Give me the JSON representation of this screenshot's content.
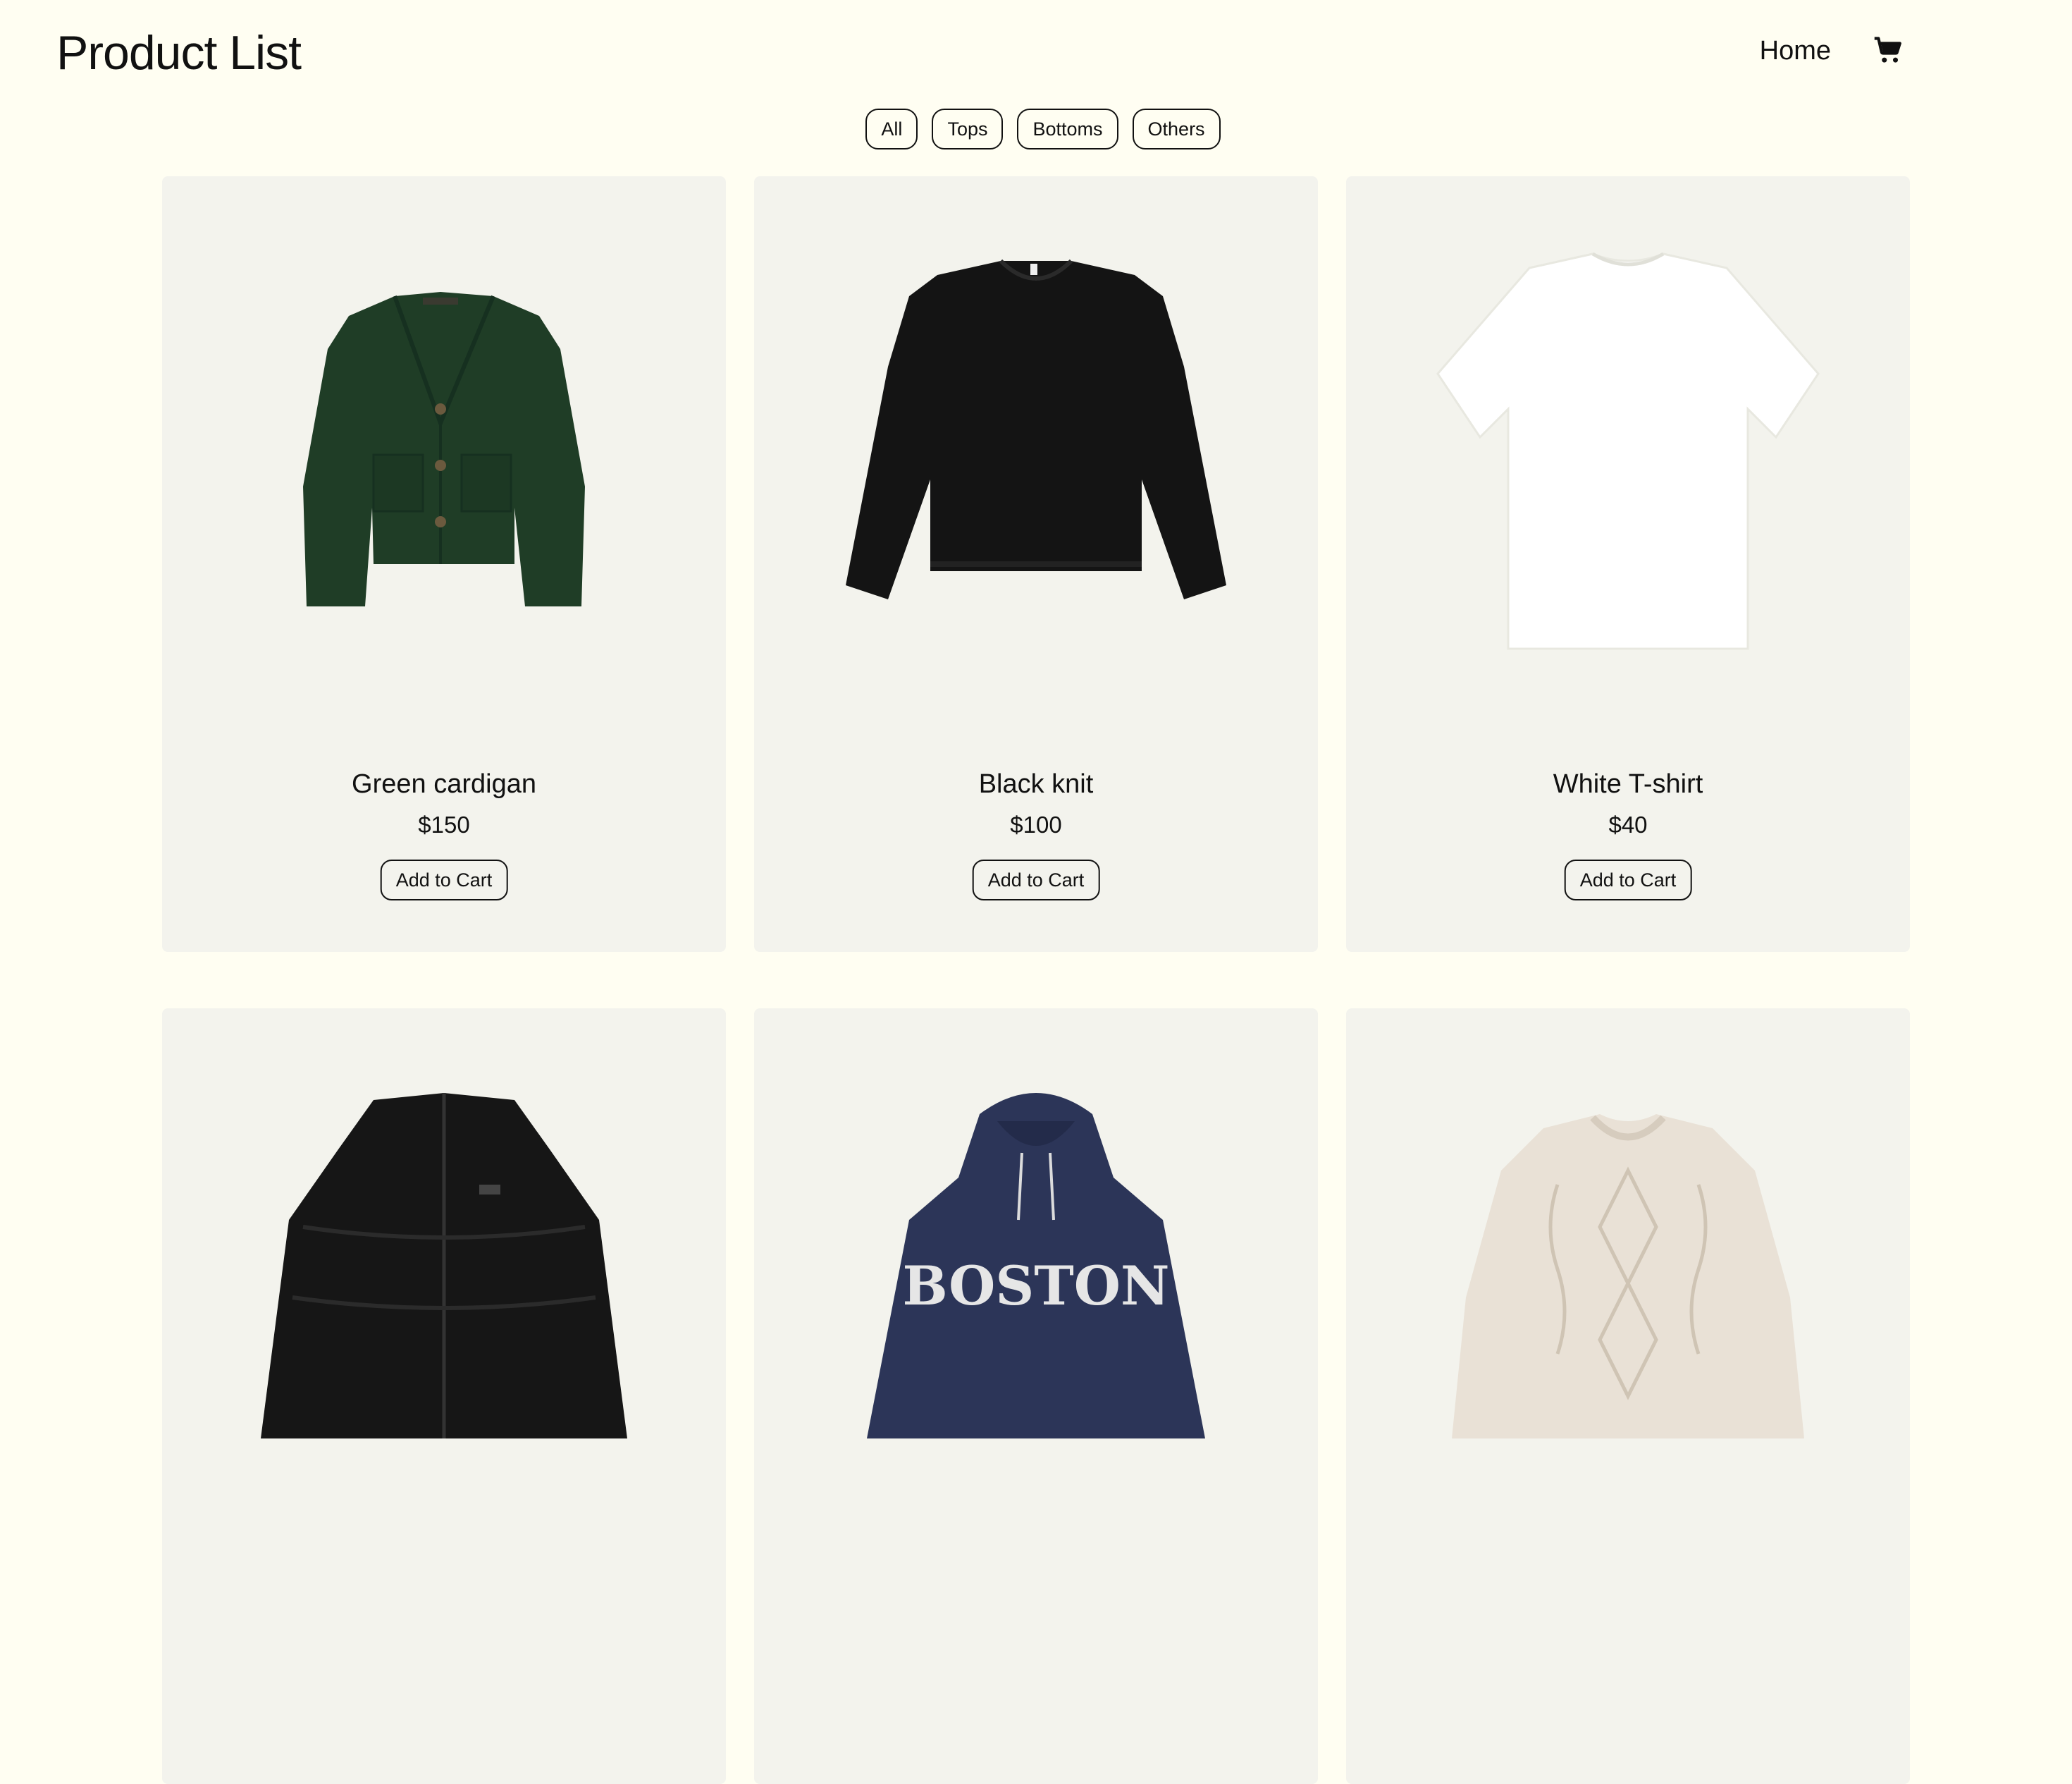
{
  "header": {
    "title": "Product List",
    "nav_home": "Home",
    "cart_icon": "shopping-cart-icon"
  },
  "filters": [
    {
      "label": "All"
    },
    {
      "label": "Tops"
    },
    {
      "label": "Bottoms"
    },
    {
      "label": "Others"
    }
  ],
  "products": [
    {
      "name": "Green cardigan",
      "price": "$150",
      "button": "Add to Cart",
      "image": "green-cardigan-image",
      "color": "#1f3d26"
    },
    {
      "name": "Black knit",
      "price": "$100",
      "button": "Add to Cart",
      "image": "black-knit-sweater-image",
      "color": "#141414"
    },
    {
      "name": "White T-shirt",
      "price": "$40",
      "button": "Add to Cart",
      "image": "white-tshirt-image",
      "color": "#ffffff"
    },
    {
      "image": "black-puffer-jacket-image",
      "color": "#161616"
    },
    {
      "image": "navy-boston-hoodie-image",
      "color": "#2c3558",
      "print_text": "BOSTON"
    },
    {
      "image": "cream-cable-knit-sweater-image",
      "color": "#e9e1d6"
    }
  ],
  "colors": {
    "background": "#fffef2",
    "card": "#f3f3ed",
    "text": "#111111"
  }
}
